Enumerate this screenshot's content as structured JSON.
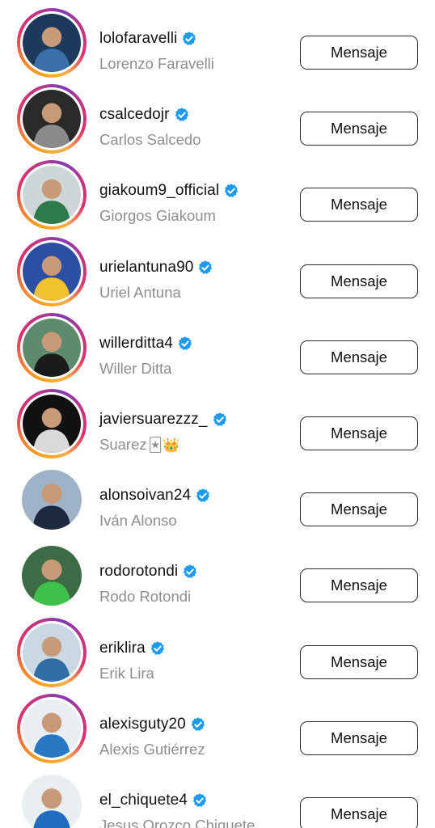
{
  "accounts": [
    {
      "username": "lolofaravelli",
      "full_name": "Lorenzo Faravelli",
      "emoji": "",
      "story_ring": true,
      "button_label": "Mensaje",
      "verified": true,
      "avatar_colors": [
        "#1d3a5c",
        "#3b6fa8"
      ]
    },
    {
      "username": "csalcedojr",
      "full_name": "Carlos Salcedo",
      "emoji": "",
      "story_ring": true,
      "button_label": "Mensaje",
      "verified": true,
      "avatar_colors": [
        "#2a2a2a",
        "#8a8a8a"
      ]
    },
    {
      "username": "giakoum9_official",
      "full_name": "Giorgos Giakoum",
      "emoji": "",
      "story_ring": true,
      "button_label": "Mensaje",
      "verified": true,
      "avatar_colors": [
        "#cfd6d8",
        "#2f7a4a"
      ]
    },
    {
      "username": "urielantuna90",
      "full_name": "Uriel Antuna",
      "emoji": "",
      "story_ring": true,
      "button_label": "Mensaje",
      "verified": true,
      "avatar_colors": [
        "#2d4fa3",
        "#f2c12e"
      ]
    },
    {
      "username": "willerditta4",
      "full_name": "Willer Ditta",
      "emoji": "",
      "story_ring": true,
      "button_label": "Mensaje",
      "verified": true,
      "avatar_colors": [
        "#5e8a6e",
        "#1b1b1b"
      ]
    },
    {
      "username": "javiersuarezzz_",
      "full_name": "Suarez",
      "emoji": "🃏👑",
      "story_ring": true,
      "button_label": "Mensaje",
      "verified": true,
      "avatar_colors": [
        "#111111",
        "#d9d9d9"
      ]
    },
    {
      "username": "alonsoivan24",
      "full_name": "Iván Alonso",
      "emoji": "",
      "story_ring": false,
      "button_label": "Mensaje",
      "verified": true,
      "avatar_colors": [
        "#9fb3c8",
        "#1e2a40"
      ]
    },
    {
      "username": "rodorotondi",
      "full_name": "Rodo Rotondi",
      "emoji": "",
      "story_ring": false,
      "button_label": "Mensaje",
      "verified": true,
      "avatar_colors": [
        "#3c6b45",
        "#3fc24a"
      ]
    },
    {
      "username": "eriklira",
      "full_name": "Erik Lira",
      "emoji": "",
      "story_ring": true,
      "button_label": "Mensaje",
      "verified": true,
      "avatar_colors": [
        "#c9d8e3",
        "#2f6fa6"
      ]
    },
    {
      "username": "alexisguty20",
      "full_name": "Alexis Gutiérrez",
      "emoji": "",
      "story_ring": true,
      "button_label": "Mensaje",
      "verified": true,
      "avatar_colors": [
        "#e8eef2",
        "#2a78c4"
      ]
    },
    {
      "username": "el_chiquete4",
      "full_name": "Jesus Orozco Chiquete",
      "emoji": "",
      "story_ring": false,
      "button_label": "Mensaje",
      "verified": true,
      "avatar_colors": [
        "#e9eef1",
        "#1f6cc0"
      ]
    }
  ],
  "colors": {
    "verified_badge": "#1d9bf0",
    "secondary_text": "#8e8e8e"
  },
  "icons": {
    "verified": "verified-badge-icon"
  }
}
